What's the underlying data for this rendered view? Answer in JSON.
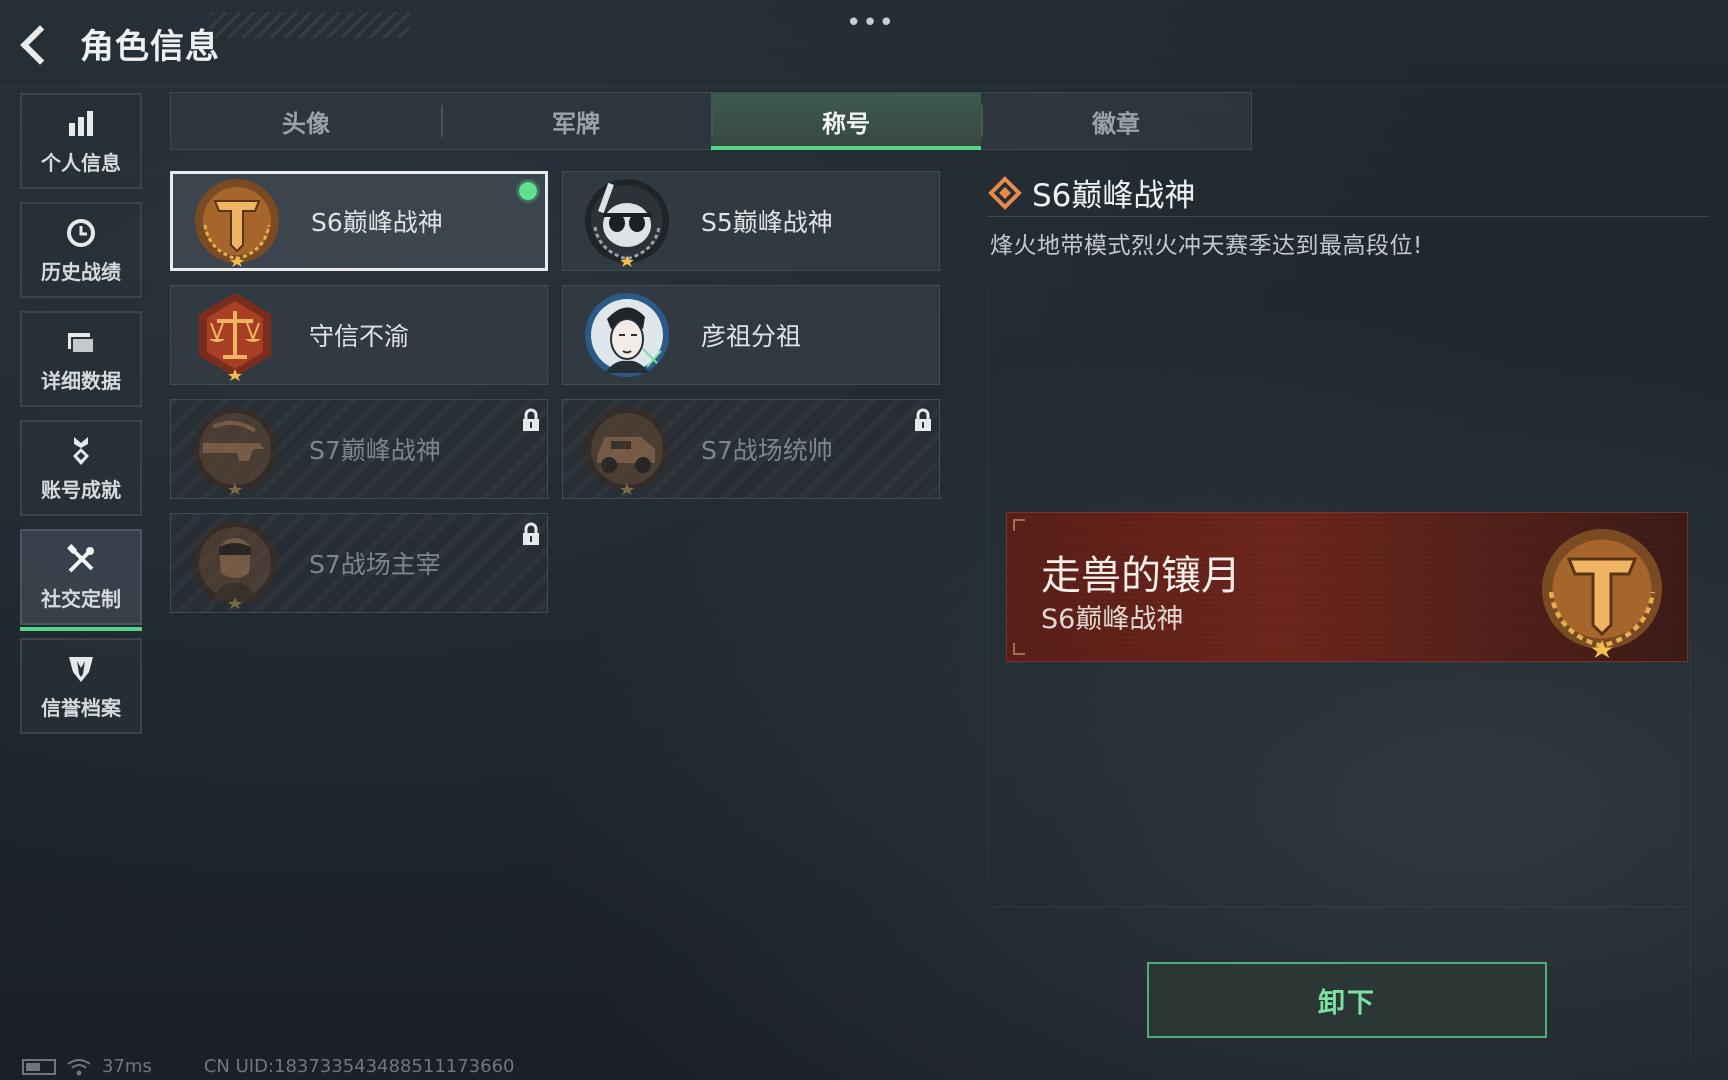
{
  "header": {
    "title": "角色信息",
    "more": "•••"
  },
  "sidebar": {
    "items": [
      {
        "label": "个人信息",
        "icon": "bar-chart-icon",
        "active": false
      },
      {
        "label": "历史战绩",
        "icon": "clock-icon",
        "active": false
      },
      {
        "label": "详细数据",
        "icon": "folder-icon",
        "active": false
      },
      {
        "label": "账号成就",
        "icon": "medal-icon",
        "active": false
      },
      {
        "label": "社交定制",
        "icon": "tools-icon",
        "active": true
      },
      {
        "label": "信誉档案",
        "icon": "shield-icon",
        "active": false
      }
    ]
  },
  "tabs": [
    {
      "label": "头像",
      "active": false
    },
    {
      "label": "军牌",
      "active": false
    },
    {
      "label": "称号",
      "active": true
    },
    {
      "label": "徽章",
      "active": false
    }
  ],
  "titles": [
    {
      "name": "S6巅峰战神",
      "emblem": "gold-t-emblem",
      "selected": true,
      "equipped": true,
      "locked": false
    },
    {
      "name": "S5巅峰战神",
      "emblem": "skull-emblem",
      "selected": false,
      "equipped": false,
      "locked": false
    },
    {
      "name": "守信不渝",
      "emblem": "scales-emblem",
      "selected": false,
      "equipped": false,
      "locked": false
    },
    {
      "name": "彦祖分祖",
      "emblem": "portrait-emblem",
      "selected": false,
      "equipped": false,
      "locked": false
    },
    {
      "name": "S7巅峰战神",
      "emblem": "rifle-emblem",
      "selected": false,
      "equipped": false,
      "locked": true
    },
    {
      "name": "S7战场统帅",
      "emblem": "vehicle-emblem",
      "selected": false,
      "equipped": false,
      "locked": true
    },
    {
      "name": "S7战场主宰",
      "emblem": "soldier-emblem",
      "selected": false,
      "equipped": false,
      "locked": true
    }
  ],
  "detail": {
    "title": "S6巅峰战神",
    "description": "烽火地带模式烈火冲天赛季达到最高段位!"
  },
  "preview": {
    "player_name": "走兽的镶月",
    "title": "S6巅峰战神"
  },
  "actions": {
    "unequip_label": "卸下"
  },
  "status": {
    "ping": "37ms",
    "uid": "CN UID:183733543488511173660"
  },
  "colors": {
    "accent": "#56d48a",
    "banner": "#6e261c",
    "gold": "#c98b3a"
  }
}
